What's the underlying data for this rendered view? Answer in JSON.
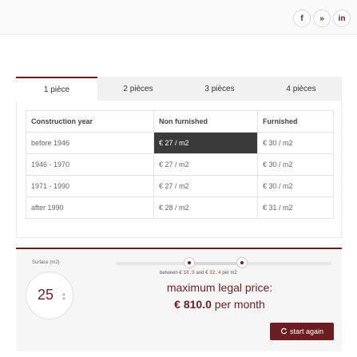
{
  "social": {
    "facebook": "f",
    "twitter": "»",
    "linkedin": "in"
  },
  "tabs": [
    {
      "label": "1 pièce",
      "active": true
    },
    {
      "label": "2 pièces",
      "active": false
    },
    {
      "label": "3 pièces",
      "active": false
    },
    {
      "label": "4 pièces",
      "active": false
    }
  ],
  "table": {
    "headers": [
      "Construction year",
      "Non furnished",
      "Furnished"
    ],
    "rows": [
      [
        "before 1946",
        "€ 27 / m2",
        "€ 30 / m2"
      ],
      [
        "1946 - 1970",
        "€ 27 / m2",
        "€ 30 / m2"
      ],
      [
        "1971 - 1990",
        "€ 27 / m2",
        "€ 30 / m2"
      ],
      [
        "after 1990",
        "€ 28 / m2",
        "€ 31 / m2"
      ]
    ],
    "highlighted_cell": "€ 27 / m2"
  },
  "calculator": {
    "surface_label": "Surface (m2)",
    "surface_value": "25",
    "between_prefix": "between €",
    "low_value": "18.9",
    "between_mid": "and €",
    "high_value": "32.4",
    "between_suffix": "per m2",
    "max_title": "maximum legal price:",
    "max_price_amount": "€ 810.0",
    "max_price_suffix": "per month",
    "restart_label": "start again"
  },
  "colors": {
    "accent": "#6b1d22",
    "highlight_cell": "#3a3a3a"
  },
  "icons": {
    "restart": "refresh-icon",
    "spinner": "spinner-arrows-icon"
  }
}
